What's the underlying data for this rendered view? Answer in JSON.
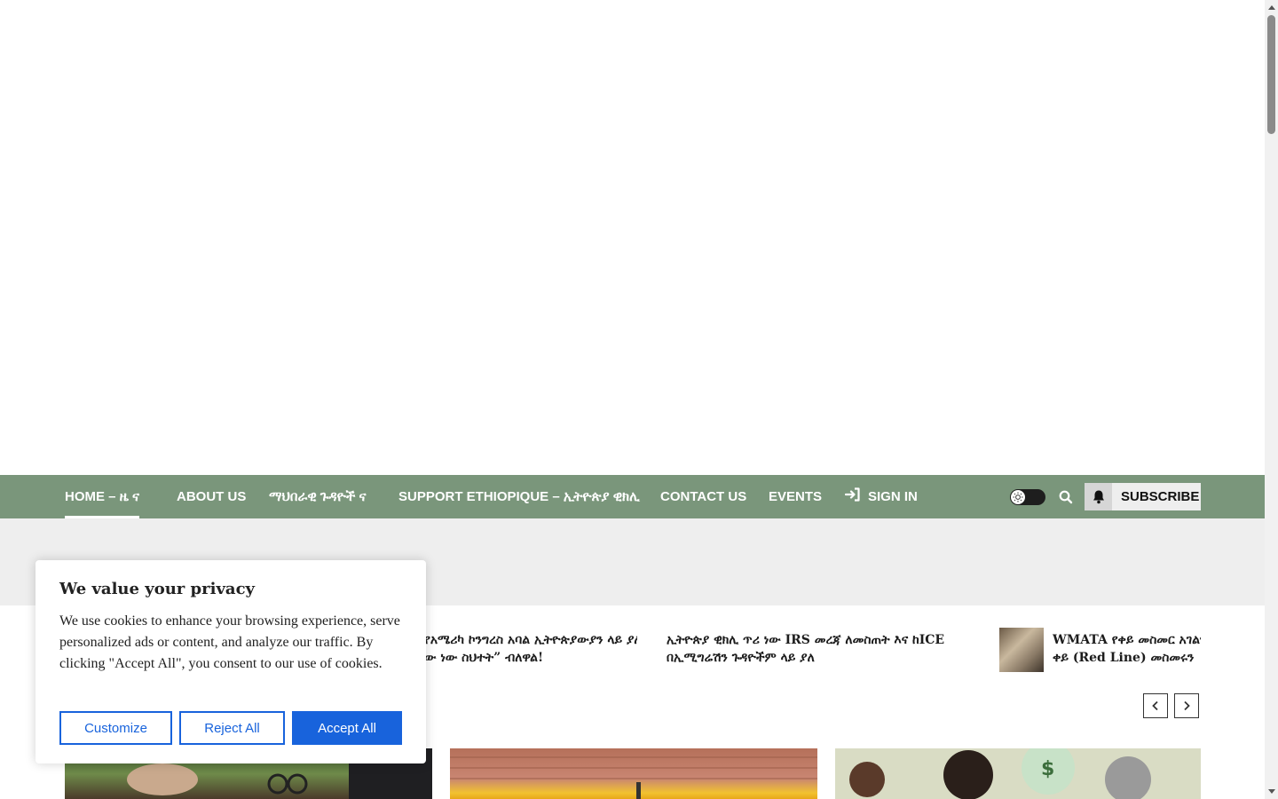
{
  "nav": {
    "items": [
      {
        "label": "HOME – ዜ ና",
        "active": true
      },
      {
        "label": "ABOUT US"
      },
      {
        "label": "ማህበራዊ ጉዳዮች ና"
      },
      {
        "label": "SUPPORT ETHIOPIQUE – ኢትዮጵያ ዊክሊ"
      },
      {
        "label": "CONTACT US"
      },
      {
        "label": "EVENTS"
      },
      {
        "label": "SIGN IN"
      }
    ],
    "subscribe_label": "SUBSCRIBE",
    "icons": {
      "signin": "sign-in-icon",
      "theme": "sun-icon",
      "search": "search-icon",
      "bell": "bell-icon"
    },
    "colors": {
      "bar": "#7a967b"
    }
  },
  "ticker": {
    "items": [
      {
        "line1": "የአሜሪካ ኮንግረስ አባል ኢትዮጵያውያን ላይ ያለ",
        "line2": "ው ነው ስህተት” ብለዋል!"
      },
      {
        "line1": "ኢትዮጵያ ዊክሊ ጥሪ ነው IRS መረጃ ለመስጠት እና ከICE",
        "line2": "በኢሚግሬሽን ጉዳዮችም ላይ ያለ"
      },
      {
        "line1": "WMATA የቀይ መስመር አገልግሎ",
        "line2": "ቀይ (Red Line) መስመሩን"
      }
    ],
    "prev_icon": "chevron-left-icon",
    "next_icon": "chevron-right-icon"
  },
  "cookie": {
    "title": "We value your privacy",
    "body": "We use cookies to enhance your browsing experience, serve personalized ads or content, and analyze our traffic. By clicking \"Accept All\", you consent to our use of cookies.",
    "customize_label": "Customize",
    "reject_label": "Reject All",
    "accept_label": "Accept All",
    "colors": {
      "accent": "#1863dc"
    }
  }
}
